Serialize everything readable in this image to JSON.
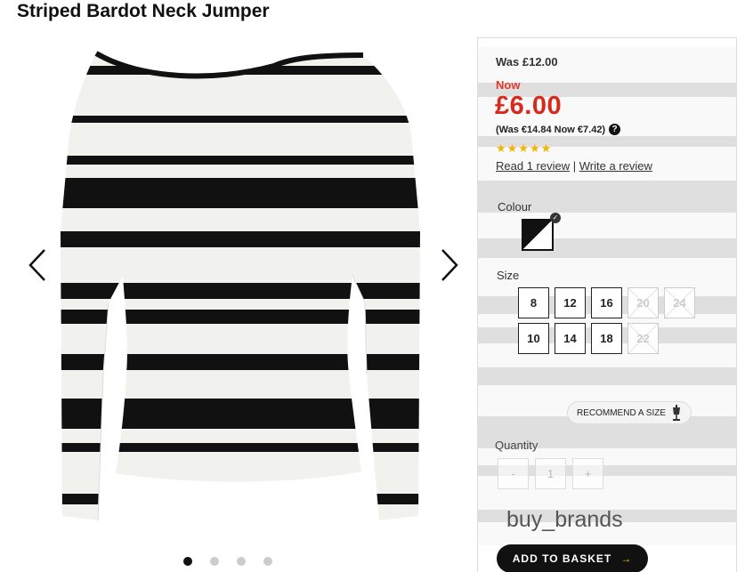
{
  "product": {
    "title": "Striped Bardot Neck Jumper"
  },
  "pricing": {
    "was": "Was £12.00",
    "now_label": "Now",
    "now_price": "£6.00",
    "euro": "(Was €14.84 Now €7.42)",
    "help_icon": "?"
  },
  "rating": {
    "stars": "★★★★★",
    "value": 5,
    "read_reviews": "Read 1 review",
    "separator": "|",
    "write_review": "Write a review"
  },
  "colour": {
    "label": "Colour",
    "check": "✓"
  },
  "size": {
    "label": "Size",
    "row1": [
      {
        "label": "8",
        "available": true
      },
      {
        "label": "12",
        "available": true
      },
      {
        "label": "16",
        "available": true
      },
      {
        "label": "20",
        "available": false
      },
      {
        "label": "24",
        "available": false
      }
    ],
    "row2": [
      {
        "label": "10",
        "available": true
      },
      {
        "label": "14",
        "available": true
      },
      {
        "label": "18",
        "available": true
      },
      {
        "label": "22",
        "available": false
      }
    ],
    "recommend": "RECOMMEND A SIZE"
  },
  "quantity": {
    "label": "Quantity",
    "minus": "-",
    "value": "1",
    "plus": "+"
  },
  "watermark": "buy_brands",
  "basket": {
    "label": "ADD TO BASKET",
    "arrow": "→"
  },
  "gallery": {
    "slides": 4,
    "active": 1
  },
  "colors": {
    "price_red": "#d8291b",
    "star_gold": "#f5b400",
    "button_black": "#111111"
  }
}
